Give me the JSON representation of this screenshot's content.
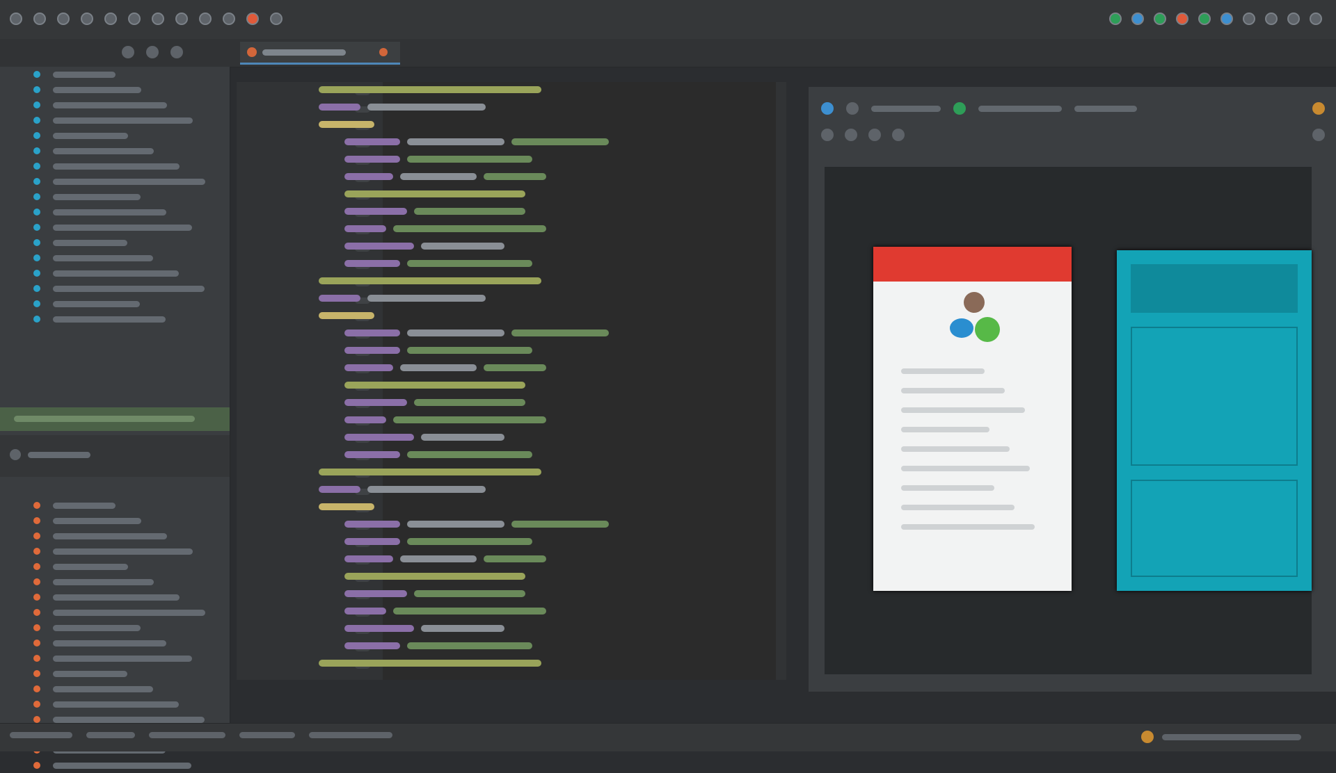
{
  "toolbar": {
    "icons_left": [
      "new-file-icon",
      "open-folder-icon",
      "save-icon",
      "undo-icon",
      "redo-icon",
      "cut-icon",
      "copy-icon",
      "paste-icon",
      "find-icon",
      "replace-icon",
      "build-icon",
      "run-icon"
    ],
    "icons_right": [
      "run-app-icon",
      "debug-icon",
      "profile-icon",
      "sync-icon",
      "avd-icon",
      "sdk-icon",
      "structure-icon",
      "device-icon",
      "search-everywhere-icon",
      "help-icon"
    ],
    "colors": {
      "accent_run": "#2e9e58",
      "accent_debug": "#e05a3a",
      "accent_info": "#3d8fd0"
    }
  },
  "tabbar": {
    "active_tab_color": "#4e87b8"
  },
  "project_tree": {
    "top_bullet_color": "#2aa2c9",
    "bottom_bullet_color": "#e06a3a",
    "selected_row_color": "#4b6147"
  },
  "editor": {
    "colors": {
      "tag": "#c7b46a",
      "attr": "#8b6fa8",
      "value": "#6a8a5a",
      "text": "#8a8f96",
      "highlight": "#9aa45a"
    }
  },
  "preview": {
    "phone_light": {
      "appbar_color": "#e03a30",
      "body_color": "#f2f3f3",
      "logo_colors": [
        "#8a6a58",
        "#2a8ed0",
        "#57b947"
      ]
    },
    "phone_dark": {
      "body_color": "#13a3b6"
    }
  }
}
